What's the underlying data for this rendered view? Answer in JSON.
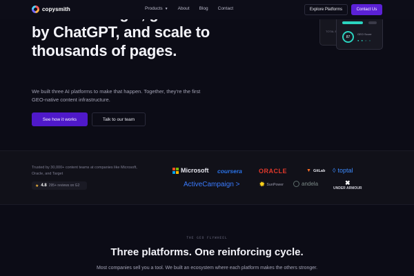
{
  "nav": {
    "brand": "copysmith",
    "links": [
      {
        "label": "Products",
        "has_menu": true
      },
      {
        "label": "About"
      },
      {
        "label": "Blog"
      },
      {
        "label": "Contact"
      }
    ],
    "explore_label": "Explore Platforms",
    "contact_label": "Contact Us",
    "accent_color": "#5b21d6"
  },
  "hero": {
    "title": "rank on Google, get cited by ChatGPT, and scale to thousands of pages.",
    "subtitle": "We built three AI platforms to make that happen. Together, they're the first GEO-native content infrastructure.",
    "primary_cta": "See how it works",
    "secondary_cta": "Talk to our team",
    "mockup": {
      "back_label": "TOTAL BL",
      "score_value": "87",
      "score_label": "GEO Score",
      "dots": "● ● ○ ○",
      "chip": "84",
      "ring_color": "#2bd4c0"
    }
  },
  "trust": {
    "text": "Trusted by 30,000+ content teams at companies like Microsoft, Oracle, and Target",
    "rating_score": "4.8",
    "rating_reviews": "295+ reviews on G2",
    "logos": {
      "microsoft": "Microsoft",
      "coursera": "coursera",
      "oracle": "ORACLE",
      "gitlab": "GitLab",
      "toptal": "toptal",
      "activecampaign": "ActiveCampaign >",
      "sunpower": "SunPower",
      "andela": "andela",
      "underarmour": "UNDER ARMOUR"
    }
  },
  "section": {
    "kicker": "THE GEO FLYWHEEL",
    "title": "Three platforms. One reinforcing cycle.",
    "subtitle": "Most companies sell you a tool. We built an ecosystem where each platform makes the others stronger."
  }
}
